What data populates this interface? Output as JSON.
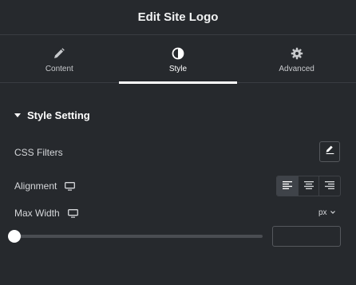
{
  "header": {
    "title": "Edit Site Logo"
  },
  "tabs": [
    {
      "label": "Content",
      "icon": "pencil-icon"
    },
    {
      "label": "Style",
      "icon": "half-circle-icon",
      "active": true
    },
    {
      "label": "Advanced",
      "icon": "gear-icon"
    }
  ],
  "section": {
    "title": "Style Setting",
    "expanded": true
  },
  "controls": {
    "css_filters": {
      "label": "CSS Filters",
      "icon": "pencil-icon"
    },
    "alignment": {
      "label": "Alignment",
      "device_icon": "desktop-icon",
      "options": [
        "align-left-icon",
        "align-center-icon",
        "align-right-icon"
      ],
      "selected": "align-left-icon"
    },
    "max_width": {
      "label": "Max Width",
      "device_icon": "desktop-icon",
      "unit": "px",
      "slider_fraction": 0,
      "value": "",
      "placeholder": ""
    }
  },
  "colors": {
    "background": "#26292d",
    "active_tab_indicator": "#ffffff",
    "border": "#3a3d42"
  }
}
